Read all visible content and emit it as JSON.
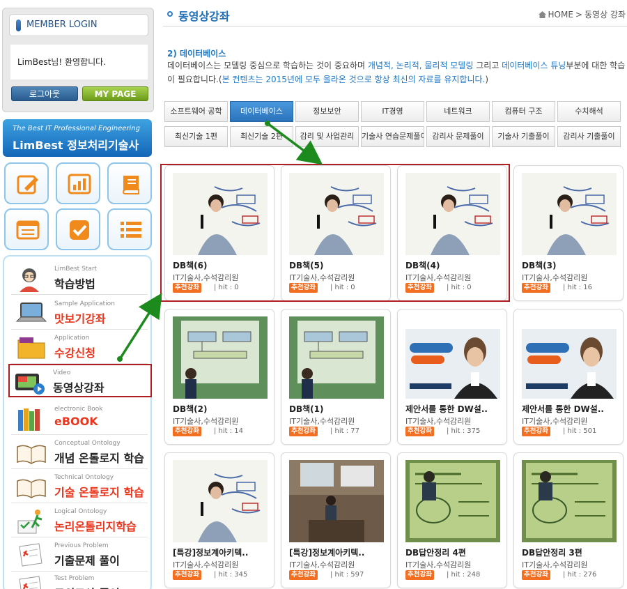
{
  "sidebar": {
    "login_title": "MEMBER LOGIN",
    "welcome": "LimBest님! 환영합니다.",
    "logout_label": "로그아웃",
    "mypage_label": "MY PAGE",
    "banner_line1": "The Best IT Professional Engineering",
    "banner_line2": "LimBest 정보처리기술사",
    "quick_icons": [
      "pencil-icon",
      "chart-icon",
      "book-icon",
      "list-icon",
      "check-icon",
      "bullet-list-icon"
    ],
    "menu": [
      {
        "en": "LimBest Start",
        "ko": "학습방법",
        "icon": "student-icon",
        "red": false
      },
      {
        "en": "Sample Application",
        "ko": "맛보기강좌",
        "icon": "laptop-icon",
        "red": true
      },
      {
        "en": "Application",
        "ko": "수강신청",
        "icon": "folder-icon",
        "red": true
      },
      {
        "en": "Video",
        "ko": "동영상강좌",
        "icon": "video-icon",
        "red": false
      },
      {
        "en": "electronic Book",
        "ko": "eBOOK",
        "icon": "ebook-icon",
        "red": true
      },
      {
        "en": "Conceptual Ontology",
        "ko": "개념 온톨로지 학습",
        "icon": "open-book-icon",
        "red": false
      },
      {
        "en": "Technical Ontology",
        "ko": "기술 온톨로지 학습",
        "icon": "open-book-icon",
        "red": true
      },
      {
        "en": "Logical Ontology",
        "ko": "논리온톨리지학습",
        "icon": "runner-icon",
        "red": true
      },
      {
        "en": "Previous Problem",
        "ko": "기출문제 풀이",
        "icon": "paper-icon",
        "red": false
      },
      {
        "en": "Test Problem",
        "ko": "모의고사 풀이",
        "icon": "paper-icon",
        "red": false
      }
    ]
  },
  "header": {
    "title": "동영상강좌",
    "breadcrumb_home": "HOME",
    "breadcrumb_sep": ">",
    "breadcrumb_current": "동영상 강좌"
  },
  "section": {
    "title": "2) 데이터베이스",
    "desc_1": "데이터베이스는 모델링 중심으로 학습하는 것이 중요하며 ",
    "desc_hl1": "개념적, 논리적, 물리적 모델링",
    "desc_2": " 그리고 ",
    "desc_hl2": "데이터베이스 튜닝",
    "desc_3": "부분에 대한 학습이 필요합니다.(",
    "desc_hl3": "본 컨텐츠는 2015년에 모두 올라온 것으로 항상 최신의 자료를 유지합니다.",
    "desc_4": ")"
  },
  "tabs_row1": [
    "소프트웨어 공학",
    "데이터베이스",
    "정보보안",
    "IT경영",
    "네트워크",
    "컴퓨터 구조",
    "수치해석"
  ],
  "tabs_row2": [
    "최신기술 1편",
    "최신기술 2편",
    "감리 및 사업관리",
    "기술사 연습문제풀이",
    "감리사 문제풀이",
    "기술사 기출풀이",
    "감리사 기출풀이"
  ],
  "active_tab": 1,
  "cards": [
    {
      "title": "DB책(6)",
      "teacher": "IT기술사,수석감리원",
      "badge": "추천강좌",
      "hit": "hit : 0",
      "scene": "room"
    },
    {
      "title": "DB책(5)",
      "teacher": "IT기술사,수석감리원",
      "badge": "추천강좌",
      "hit": "hit : 0",
      "scene": "room"
    },
    {
      "title": "DB책(4)",
      "teacher": "IT기술사,수석감리원",
      "badge": "추천강좌",
      "hit": "hit : 0",
      "scene": "room"
    },
    {
      "title": "DB책(3)",
      "teacher": "IT기술사,수석감리원",
      "badge": "추천강좌",
      "hit": "hit : 16",
      "scene": "room"
    },
    {
      "title": "DB책(2)",
      "teacher": "IT기술사,수석감리원",
      "badge": "추천강좌",
      "hit": "hit : 14",
      "scene": "screen"
    },
    {
      "title": "DB책(1)",
      "teacher": "IT기술사,수석감리원",
      "badge": "추천강좌",
      "hit": "hit : 77",
      "scene": "screen"
    },
    {
      "title": "제안서를 통한 DW설..",
      "teacher": "IT기술사,수석감리원",
      "badge": "추천강좌",
      "hit": "hit : 375",
      "scene": "slide"
    },
    {
      "title": "제안서를 통한 DW설..",
      "teacher": "IT기술사,수석감리원",
      "badge": "추천강좌",
      "hit": "hit : 501",
      "scene": "slide"
    },
    {
      "title": "[특강]정보계아키텍..",
      "teacher": "IT기술사,수석감리원",
      "badge": "추천강좌",
      "hit": "hit : 345",
      "scene": "room"
    },
    {
      "title": "[특강]정보계아키텍..",
      "teacher": "IT기술사,수석감리원",
      "badge": "추천강좌",
      "hit": "hit : 597",
      "scene": "hall"
    },
    {
      "title": "DB답안정리 4편",
      "teacher": "IT기술사,수석감리원",
      "badge": "추천강좌",
      "hit": "hit : 248",
      "scene": "green"
    },
    {
      "title": "DB답안정리 3편",
      "teacher": "IT기술사,수석감리원",
      "badge": "추천강좌",
      "hit": "hit : 276",
      "scene": "green"
    }
  ],
  "colors": {
    "accent": "#1f78c4",
    "badge": "#f26f21",
    "highlight": "#b01e24",
    "arrow": "#1d8a1d"
  }
}
